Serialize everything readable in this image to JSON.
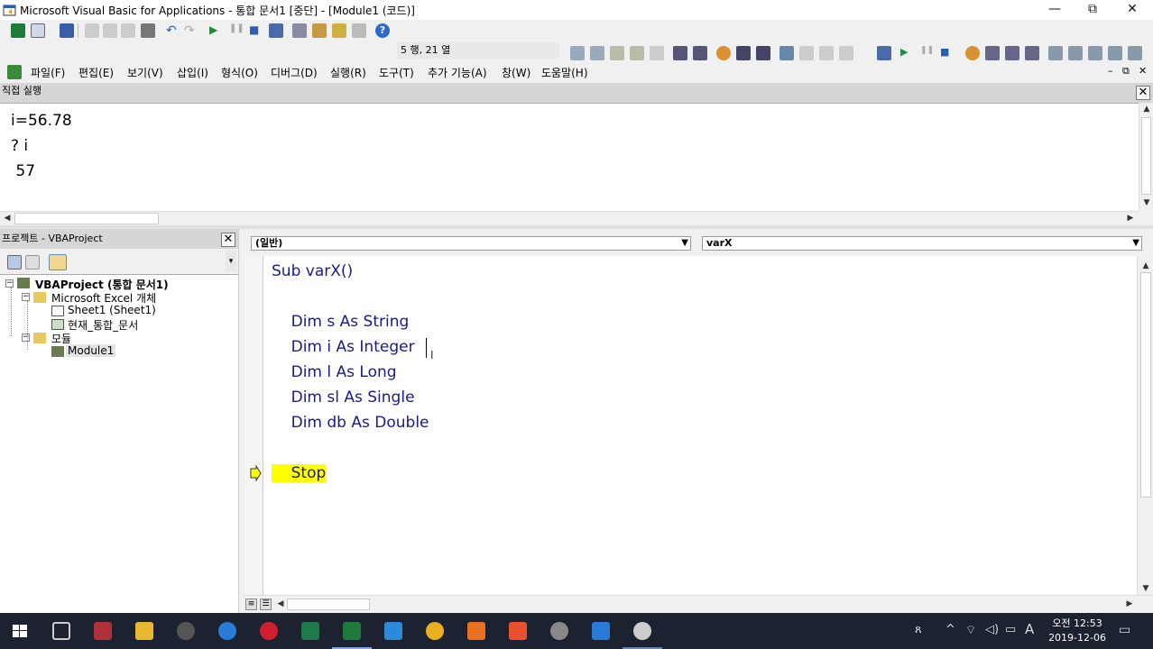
{
  "window": {
    "title": "Microsoft Visual Basic for Applications - 통합 문서1 [중단] - [Module1 (코드)]",
    "minimize": "—",
    "restore": "⧉",
    "close": "✕"
  },
  "toolbar": {
    "position_indicator": "5 행, 21 열"
  },
  "menu": {
    "items": [
      "파일(F)",
      "편집(E)",
      "보기(V)",
      "삽입(I)",
      "형식(O)",
      "디버그(D)",
      "실행(R)",
      "도구(T)",
      "추가 기능(A)",
      "창(W)",
      "도움말(H)"
    ],
    "min": "–",
    "restore": "⧉",
    "close": "✕"
  },
  "immediate": {
    "title": "직접 실행",
    "lines": [
      "i=56.78",
      "? i",
      " 57"
    ]
  },
  "project": {
    "title": "프로젝트 - VBAProject",
    "root": "VBAProject (통합 문서1)",
    "excel_objects": "Microsoft Excel 개체",
    "sheet1": "Sheet1 (Sheet1)",
    "workbook": "현재_통합_문서",
    "modules": "모듈",
    "module1": "Module1"
  },
  "code": {
    "object_dropdown": "(일반)",
    "proc_dropdown": "varX",
    "lines": [
      "Sub varX()",
      "",
      "    Dim s As String",
      "    Dim i As Integer",
      "    Dim l As Long",
      "    Dim sl As Single",
      "    Dim db As Double",
      "",
      "    Stop"
    ]
  },
  "taskbar": {
    "time": "오전 12:53",
    "date": "2019-12-06",
    "ime": "A"
  }
}
